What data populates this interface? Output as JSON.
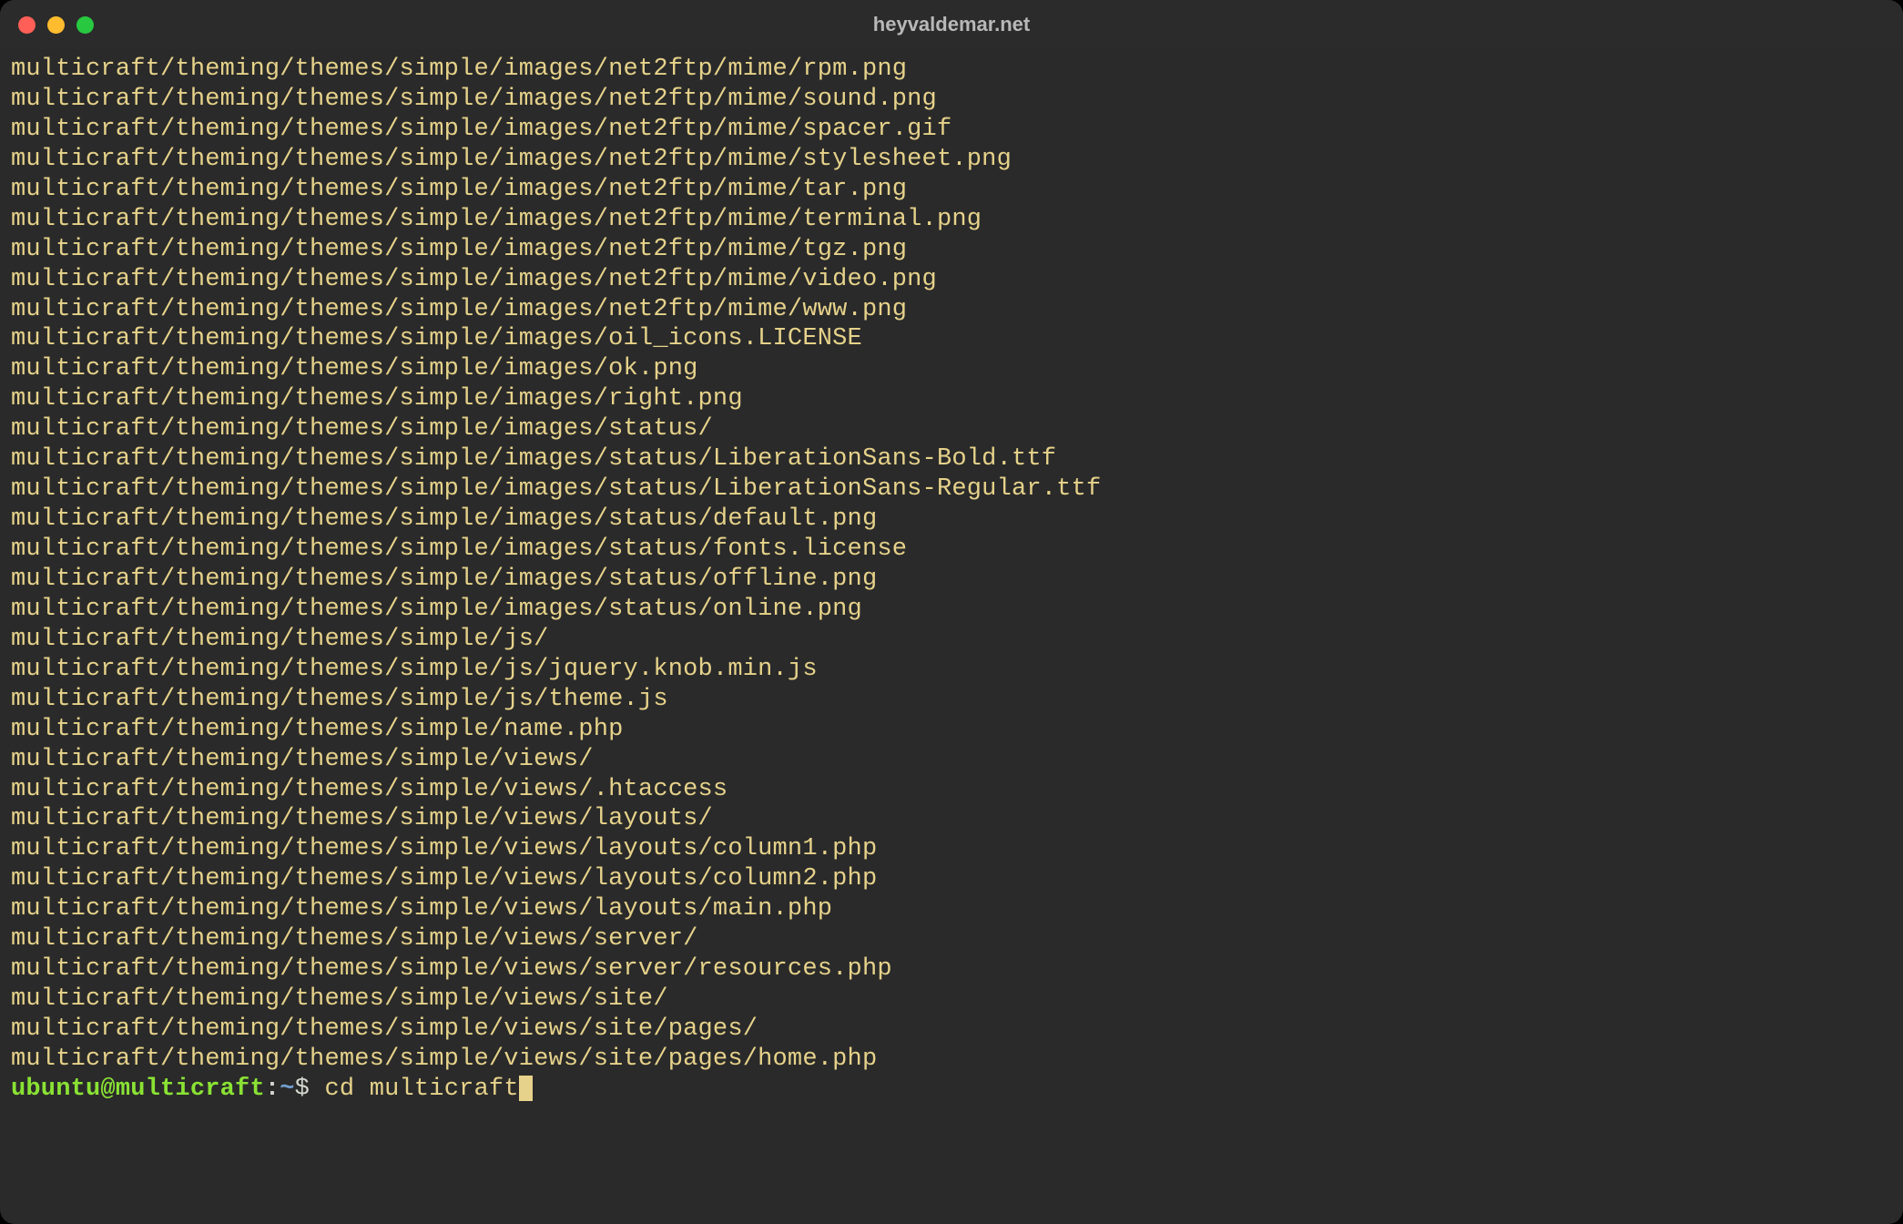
{
  "window": {
    "title": "heyvaldemar.net"
  },
  "output_lines": [
    "multicraft/theming/themes/simple/images/net2ftp/mime/rpm.png",
    "multicraft/theming/themes/simple/images/net2ftp/mime/sound.png",
    "multicraft/theming/themes/simple/images/net2ftp/mime/spacer.gif",
    "multicraft/theming/themes/simple/images/net2ftp/mime/stylesheet.png",
    "multicraft/theming/themes/simple/images/net2ftp/mime/tar.png",
    "multicraft/theming/themes/simple/images/net2ftp/mime/terminal.png",
    "multicraft/theming/themes/simple/images/net2ftp/mime/tgz.png",
    "multicraft/theming/themes/simple/images/net2ftp/mime/video.png",
    "multicraft/theming/themes/simple/images/net2ftp/mime/www.png",
    "multicraft/theming/themes/simple/images/oil_icons.LICENSE",
    "multicraft/theming/themes/simple/images/ok.png",
    "multicraft/theming/themes/simple/images/right.png",
    "multicraft/theming/themes/simple/images/status/",
    "multicraft/theming/themes/simple/images/status/LiberationSans-Bold.ttf",
    "multicraft/theming/themes/simple/images/status/LiberationSans-Regular.ttf",
    "multicraft/theming/themes/simple/images/status/default.png",
    "multicraft/theming/themes/simple/images/status/fonts.license",
    "multicraft/theming/themes/simple/images/status/offline.png",
    "multicraft/theming/themes/simple/images/status/online.png",
    "multicraft/theming/themes/simple/js/",
    "multicraft/theming/themes/simple/js/jquery.knob.min.js",
    "multicraft/theming/themes/simple/js/theme.js",
    "multicraft/theming/themes/simple/name.php",
    "multicraft/theming/themes/simple/views/",
    "multicraft/theming/themes/simple/views/.htaccess",
    "multicraft/theming/themes/simple/views/layouts/",
    "multicraft/theming/themes/simple/views/layouts/column1.php",
    "multicraft/theming/themes/simple/views/layouts/column2.php",
    "multicraft/theming/themes/simple/views/layouts/main.php",
    "multicraft/theming/themes/simple/views/server/",
    "multicraft/theming/themes/simple/views/server/resources.php",
    "multicraft/theming/themes/simple/views/site/",
    "multicraft/theming/themes/simple/views/site/pages/",
    "multicraft/theming/themes/simple/views/site/pages/home.php"
  ],
  "prompt": {
    "user_host": "ubuntu@multicraft",
    "colon": ":",
    "path": "~",
    "dollar": "$ ",
    "command": "cd multicraft"
  }
}
